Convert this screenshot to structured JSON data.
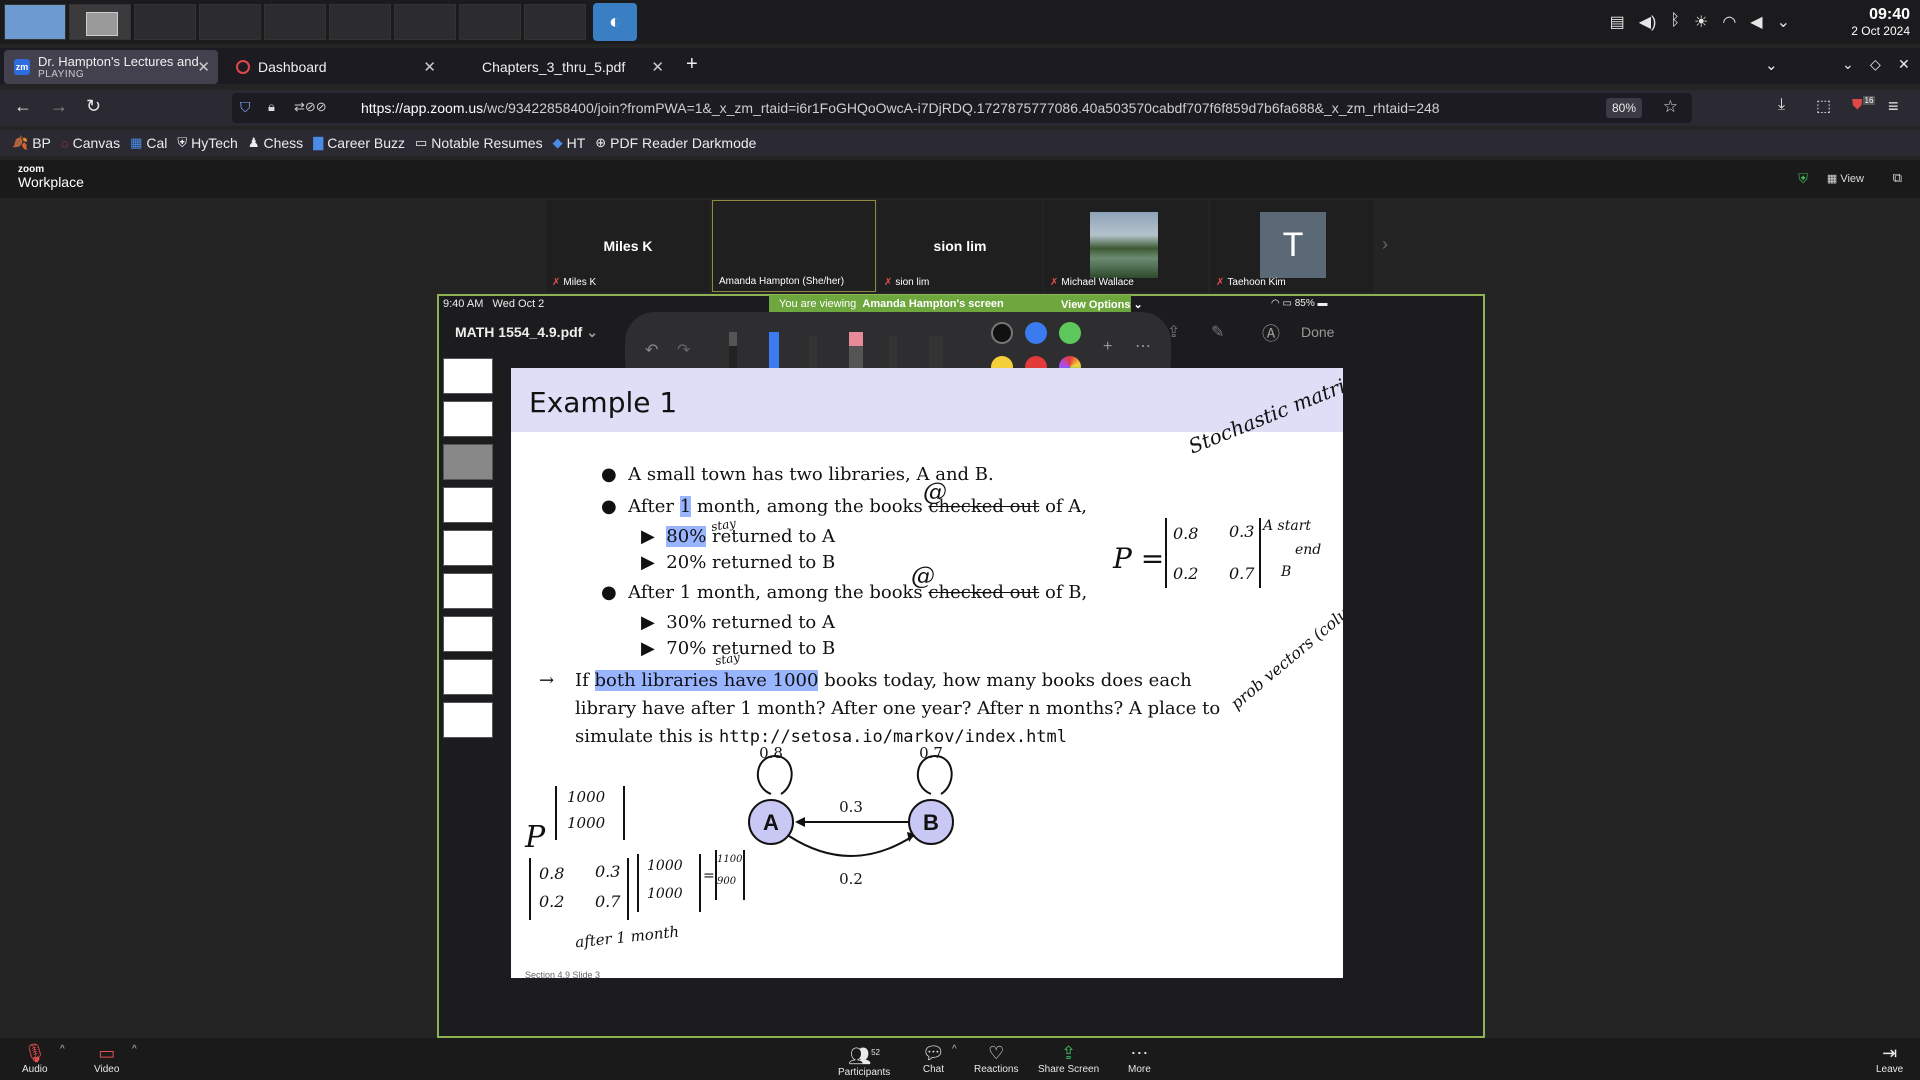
{
  "os": {
    "time": "09:40",
    "date": "2 Oct 2024"
  },
  "browser": {
    "tabs": [
      {
        "title": "Dr. Hampton's Lectures and",
        "sub": "PLAYING",
        "icon": "zm"
      },
      {
        "title": "Dashboard"
      },
      {
        "title": "Chapters_3_thru_5.pdf"
      }
    ],
    "url_host": "https://app.zoom.us",
    "url_path": "/wc/93422858400/join?fromPWA=1&_x_zm_rtaid=i6r1FoGHQoOwcA-i7DjRDQ.1727875777086.40a503570cabdf707f6f859d7b6fa688&_x_zm_rhtaid=248",
    "zoom_level": "80%",
    "ext_badge": "16",
    "bookmarks": [
      {
        "label": "BP",
        "icon": "🍂"
      },
      {
        "label": "Canvas",
        "icon": "◌"
      },
      {
        "label": "Cal",
        "icon": "▦"
      },
      {
        "label": "HyTech",
        "icon": "⛨"
      },
      {
        "label": "Chess",
        "icon": "♟"
      },
      {
        "label": "Career Buzz",
        "icon": "▇"
      },
      {
        "label": "Notable Resumes",
        "icon": "▭"
      },
      {
        "label": "HT",
        "icon": "◆"
      },
      {
        "label": "PDF Reader Darkmode",
        "icon": "⊕"
      }
    ]
  },
  "zoom": {
    "logo_small": "zoom",
    "logo_big": "Workplace",
    "view_label": "View",
    "participants": [
      {
        "display": "Miles K",
        "label": "Miles K",
        "muted": true
      },
      {
        "display": "",
        "label": "Amanda Hampton (She/her)",
        "muted": false
      },
      {
        "display": "sion lim",
        "label": "sion lim",
        "muted": true
      },
      {
        "display": "",
        "label": "Michael Wallace",
        "muted": true
      },
      {
        "display": "T",
        "label": "Taehoon Kim",
        "muted": true
      }
    ],
    "viewing_text": "You are viewing",
    "viewing_who": "Amanda Hampton's screen",
    "view_options": "View Options",
    "controls": {
      "audio": "Audio",
      "video": "Video",
      "participants": "Participants",
      "participants_count": "52",
      "chat": "Chat",
      "reactions": "Reactions",
      "share": "Share Screen",
      "more": "More",
      "leave": "Leave"
    }
  },
  "ipad": {
    "status_time": "9:40 AM",
    "status_date": "Wed Oct 2",
    "battery": "85%",
    "doc_title": "MATH 1554_4.9.pdf",
    "done": "Done",
    "pen_colors": [
      "#111111",
      "#3a7bf0",
      "#5cc85c",
      "#f5cf3a",
      "#e23a3a"
    ]
  },
  "slide": {
    "title": "Example 1",
    "l1": "A small town has two libraries, A and B.",
    "l2a": "After",
    "l2b": "1",
    "l2c": "month, among the books",
    "l2d": "checked out",
    "l2e": "of A,",
    "s1a": "80%",
    "s1b": "returned to A",
    "s2": "20% returned to B",
    "l3a": "After 1 month, among the books",
    "l3b": "checked out",
    "l3c": "of B,",
    "s3": "30% returned to A",
    "s4": "70% returned to B",
    "q1a": "If",
    "q1b": "both libraries have 1000",
    "q1c": "books today, how many books does each",
    "q2": "library have after 1 month? After one year? After n months? A place to",
    "q3a": "simulate this is",
    "q3b": "http://setosa.io/markov/index.html",
    "footer": "Section 4.9   Slide 3",
    "graph": {
      "node_a": "A",
      "node_b": "B",
      "self_a": "0.8",
      "self_b": "0.7",
      "ab": "0.3",
      "ba": "0.2"
    },
    "ink": {
      "stochastic": "Stochastic matrix",
      "p_eq": "P =",
      "m11": "0.8",
      "m12": "0.3",
      "m21": "0.2",
      "m22": "0.7",
      "start": "A start",
      "end": "end",
      "b_row": "B",
      "prob": "prob vectors (columns)",
      "stay": "stay",
      "at1": "@",
      "p_vec": "P",
      "v1": "1000",
      "v2": "1000",
      "r1": "1100",
      "r2": "900",
      "after": "after 1 month",
      "eq": "="
    }
  }
}
